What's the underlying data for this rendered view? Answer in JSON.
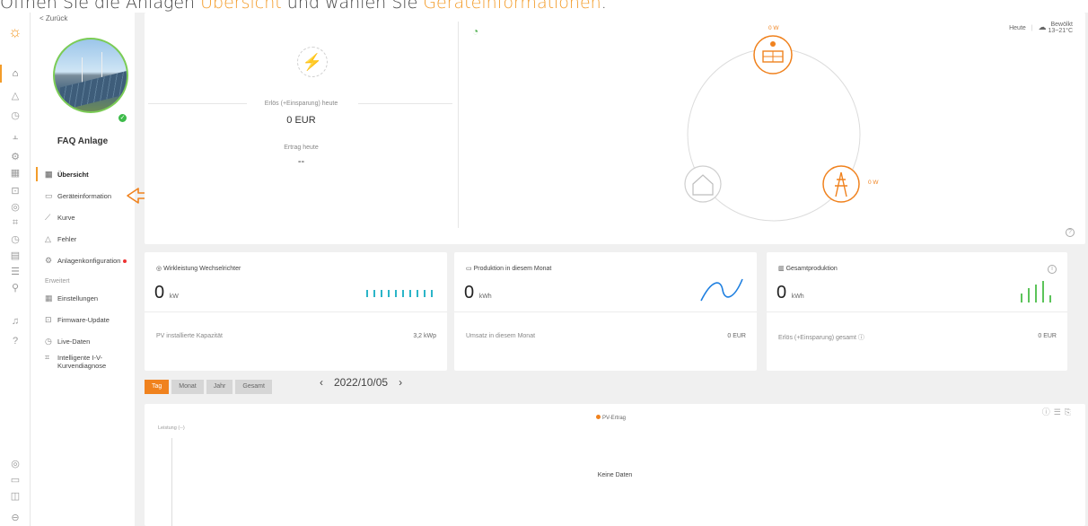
{
  "banner": {
    "pre": "Öffnen Sie die Anlagen ",
    "link1": "Übersicht",
    "mid": " und wählen Sie ",
    "link2": "Geräteinformationen",
    "post": "."
  },
  "nav": {
    "back": "< Zurück",
    "plant_name": "FAQ Anlage",
    "items": [
      {
        "icon": "▦",
        "label": "Übersicht"
      },
      {
        "icon": "▭",
        "label": "Geräteinformation"
      },
      {
        "icon": "⟋",
        "label": "Kurve"
      },
      {
        "icon": "△",
        "label": "Fehler"
      },
      {
        "icon": "⚙",
        "label": "Anlagenkonfiguration"
      }
    ],
    "section": "Erweitert",
    "adv_items": [
      {
        "icon": "▦",
        "label": "Einstellungen"
      },
      {
        "icon": "⊡",
        "label": "Firmware-Update"
      },
      {
        "icon": "◷",
        "label": "Live-Daten"
      },
      {
        "icon": "⌗",
        "label": "Intelligente I-V-"
      },
      {
        "icon": "",
        "label": "Kurvendiagnose"
      }
    ]
  },
  "overview": {
    "revenue_label": "Erlös (+Einsparung) heute",
    "revenue_value": "0 EUR",
    "yield_label": "Ertrag heute",
    "yield_value": "--",
    "pv_power": "0 W",
    "grid_power": "0 W",
    "weather_today": "Heute",
    "weather_cond": "Bewölkt",
    "weather_temp": "13~21°C"
  },
  "kpis": [
    {
      "title": "Wirkleistung Wechselrichter",
      "value": "0",
      "unit": "kW",
      "foot_label": "PV installierte Kapazität",
      "foot_value": "3,2 kWp"
    },
    {
      "title": "Produktion in diesem Monat",
      "value": "0",
      "unit": "kWh",
      "foot_label": "Umsatz in diesem Monat",
      "foot_value": "0 EUR"
    },
    {
      "title": "Gesamtproduktion",
      "value": "0",
      "unit": "kWh",
      "foot_label": "Erlös (+Einsparung) gesamt ⓘ",
      "foot_value": "0 EUR"
    }
  ],
  "period_tabs": [
    "Tag",
    "Monat",
    "Jahr",
    "Gesamt"
  ],
  "date": "2022/10/05",
  "chart": {
    "legend": "PV-Ertrag",
    "ylabel": "Leistung (--)",
    "empty": "Keine Daten"
  },
  "colors": {
    "accent": "#f0821e",
    "ok": "#3dbb4a",
    "kpi1": "#2bb5c8",
    "kpi2": "#1e7fe0",
    "kpi3": "#5cc45a"
  }
}
